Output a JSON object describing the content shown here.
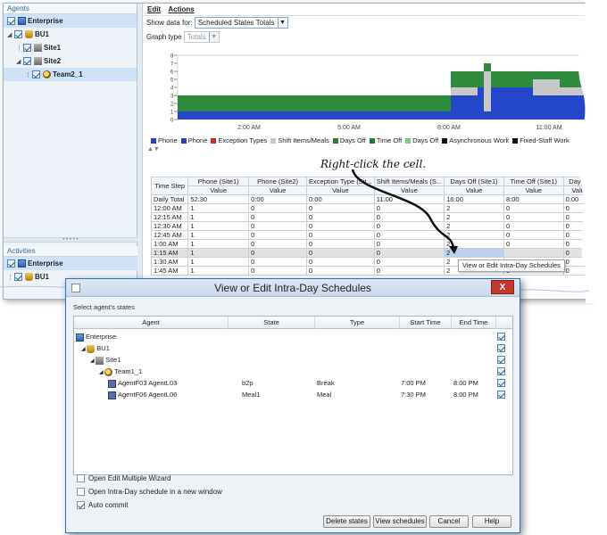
{
  "left_pane": {
    "agents_title": "Agents",
    "tree": [
      {
        "label": "Enterprise",
        "icon": "enterprise-icon",
        "depth": 0,
        "bold": true
      },
      {
        "label": "BU1",
        "icon": "bu-icon",
        "depth": 1,
        "bold": true
      },
      {
        "label": "Site1",
        "icon": "site-icon",
        "depth": 2,
        "bold": true
      },
      {
        "label": "Site2",
        "icon": "site-icon",
        "depth": 2,
        "bold": true
      },
      {
        "label": "Team2_1",
        "icon": "team-icon",
        "depth": 3,
        "bold": true
      }
    ],
    "activities_title": "Activities",
    "activities": [
      {
        "label": "Enterprise",
        "icon": "enterprise-icon"
      },
      {
        "label": "BU1",
        "icon": "bu-icon"
      }
    ]
  },
  "menu": {
    "edit": "Edit",
    "actions": "Actions"
  },
  "controls": {
    "show_data_label": "Show data for:",
    "show_data_value": "Scheduled States Totals",
    "graph_type_label": "Graph type",
    "graph_type_value": "Totals"
  },
  "chart_data": {
    "type": "area",
    "x_ticks": [
      "2:00 AM",
      "5:00 AM",
      "8:00 AM",
      "11:00 AM"
    ],
    "y_ticks": [
      "0",
      "1",
      "2",
      "3",
      "4",
      "5",
      "6",
      "7",
      "8"
    ],
    "ylim": [
      0,
      8
    ],
    "series_colors": {
      "blue": "#2446c9",
      "green": "#2e8b3c",
      "gray": "#c8c8c8"
    }
  },
  "legend": [
    {
      "label": "Phone",
      "color": "#1f3fbf"
    },
    {
      "label": "Phone",
      "color": "#1f3fbf"
    },
    {
      "label": "Exception Types",
      "color": "#d22b2b"
    },
    {
      "label": "Shift Items/Meals",
      "color": "#c8c8c8"
    },
    {
      "label": "Days Off",
      "color": "#2e7d32"
    },
    {
      "label": "Time Off",
      "color": "#1f7a33"
    },
    {
      "label": "Days Off",
      "color": "#7ccf7c"
    },
    {
      "label": "Asynchronous Work",
      "color": "#111111"
    },
    {
      "label": "Fixed-Staff Work",
      "color": "#111111"
    }
  ],
  "annotation": "Right-click the cell.",
  "grid": {
    "time_header": "Time Step",
    "columns": [
      "Phone (Site1)",
      "Phone (Site2)",
      "Exception Type (Sit...",
      "Shift Items/Meals (S...",
      "Days Off (Site1)",
      "Time Off (Site1)",
      "Days O"
    ],
    "subheader": "Value",
    "rows": [
      {
        "time": "Daily Total",
        "vals": [
          "52:30",
          "0:00",
          "0:00",
          "11:00",
          "16:00",
          "8:00",
          "0:00"
        ]
      },
      {
        "time": "12:00 AM",
        "vals": [
          "1",
          "0",
          "0",
          "0",
          "2",
          "0",
          "0"
        ]
      },
      {
        "time": "12:15 AM",
        "vals": [
          "1",
          "0",
          "0",
          "0",
          "2",
          "0",
          "0"
        ]
      },
      {
        "time": "12:30 AM",
        "vals": [
          "1",
          "0",
          "0",
          "0",
          "2",
          "0",
          "0"
        ]
      },
      {
        "time": "12:45 AM",
        "vals": [
          "1",
          "0",
          "0",
          "0",
          "2",
          "0",
          "0"
        ]
      },
      {
        "time": "1:00 AM",
        "vals": [
          "1",
          "0",
          "0",
          "0",
          "2",
          "0",
          "0"
        ]
      },
      {
        "time": "1:15 AM",
        "vals": [
          "1",
          "0",
          "0",
          "0",
          "2",
          "",
          "0"
        ]
      },
      {
        "time": "1:30 AM",
        "vals": [
          "1",
          "0",
          "0",
          "0",
          "2",
          "0",
          "0"
        ]
      },
      {
        "time": "1:45 AM",
        "vals": [
          "1",
          "0",
          "0",
          "0",
          "2",
          "0",
          "0"
        ]
      }
    ]
  },
  "context_menu": "View or Edit Intra-Day Schedules",
  "dialog": {
    "title": "View or Edit Intra-Day Schedules",
    "close": "X",
    "subtitle": "Select agent's states",
    "headers": [
      "Agent",
      "State",
      "Type",
      "Start Time",
      "End Time"
    ],
    "rows": [
      {
        "agent": "Enterprise",
        "icon": "enterprise-icon",
        "state": "",
        "type": "",
        "start": "",
        "end": ""
      },
      {
        "agent": "BU1",
        "icon": "bu-icon",
        "state": "",
        "type": "",
        "start": "",
        "end": ""
      },
      {
        "agent": "Site1",
        "icon": "site-icon",
        "state": "",
        "type": "",
        "start": "",
        "end": ""
      },
      {
        "agent": "Team1_1",
        "icon": "team-icon",
        "state": "",
        "type": "",
        "start": "",
        "end": ""
      },
      {
        "agent": "AgentF03 AgentL03",
        "icon": "agent-icon",
        "state": "b2p",
        "type": "Break",
        "start": "7:00 PM",
        "end": "8:00 PM"
      },
      {
        "agent": "AgentF06 AgentL06",
        "icon": "agent-icon",
        "state": "Meal1",
        "type": "Meal",
        "start": "7:30 PM",
        "end": "8:00 PM"
      }
    ],
    "options": [
      {
        "label": "Open Edit Multiple Wizard",
        "checked": false
      },
      {
        "label": "Open Intra-Day schedule in a new window",
        "checked": false
      },
      {
        "label": "Auto commit",
        "checked": true
      }
    ],
    "buttons": {
      "delete": "Delete states",
      "view": "View schedules",
      "cancel": "Cancel",
      "help": "Help"
    }
  }
}
